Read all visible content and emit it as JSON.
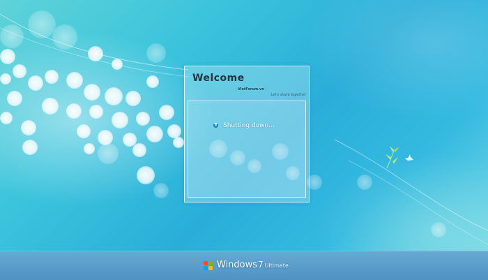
{
  "login_panel": {
    "title": "Welcome",
    "brand_name": "VietForum.vn",
    "tagline": "Let's share together",
    "status_text": "Shutting down..."
  },
  "taskbar": {
    "product": "Windows",
    "version": "7",
    "edition": "Ultimate"
  },
  "icons": {
    "busy": "busy-spinner-icon",
    "logo": "windows-logo-icon",
    "bird": "bird-icon"
  },
  "colors": {
    "background": "#3cc4dc",
    "taskbar": "#5a9fcd",
    "title_text": "#25353f"
  }
}
